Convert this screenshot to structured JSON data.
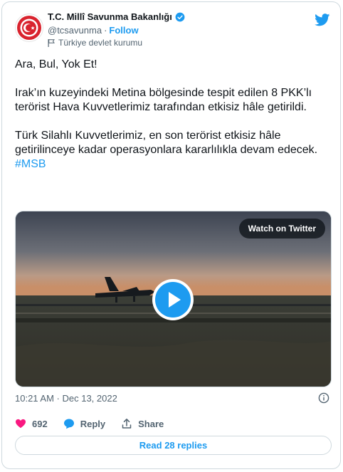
{
  "author": {
    "name": "T.C. Millî Savunma Bakanlığı",
    "handle": "@tcsavunma",
    "separator": "·",
    "follow_label": "Follow",
    "account_label": "Türkiye devlet kurumu",
    "avatar_icon": "mod-emblem-icon",
    "verified_icon": "verified-badge-icon"
  },
  "tweet": {
    "paragraphs": [
      "Ara, Bul, Yok Et!",
      "Irak’ın kuzeyindeki Metina bölgesinde tespit edilen 8 PKK’lı terörist Hava Kuvvetlerimiz tarafından etkisiz hâle getirildi.",
      "Türk Silahlı Kuvvetlerimiz, en son terörist etkisiz hâle getirilinceye kadar operasyonlara kararlılıkla devam edecek."
    ],
    "hashtag": "#MSB"
  },
  "media": {
    "watch_label": "Watch on Twitter",
    "play_icon": "play-icon"
  },
  "timestamp": "10:21 AM · Dec 13, 2022",
  "actions": {
    "like_count": "692",
    "reply_label": "Reply",
    "share_label": "Share"
  },
  "read_replies_label": "Read 28 replies",
  "colors": {
    "accent": "#1d9bf0",
    "like": "#f91880",
    "text": "#0f1419",
    "muted": "#536471",
    "border": "#cfd9de"
  }
}
